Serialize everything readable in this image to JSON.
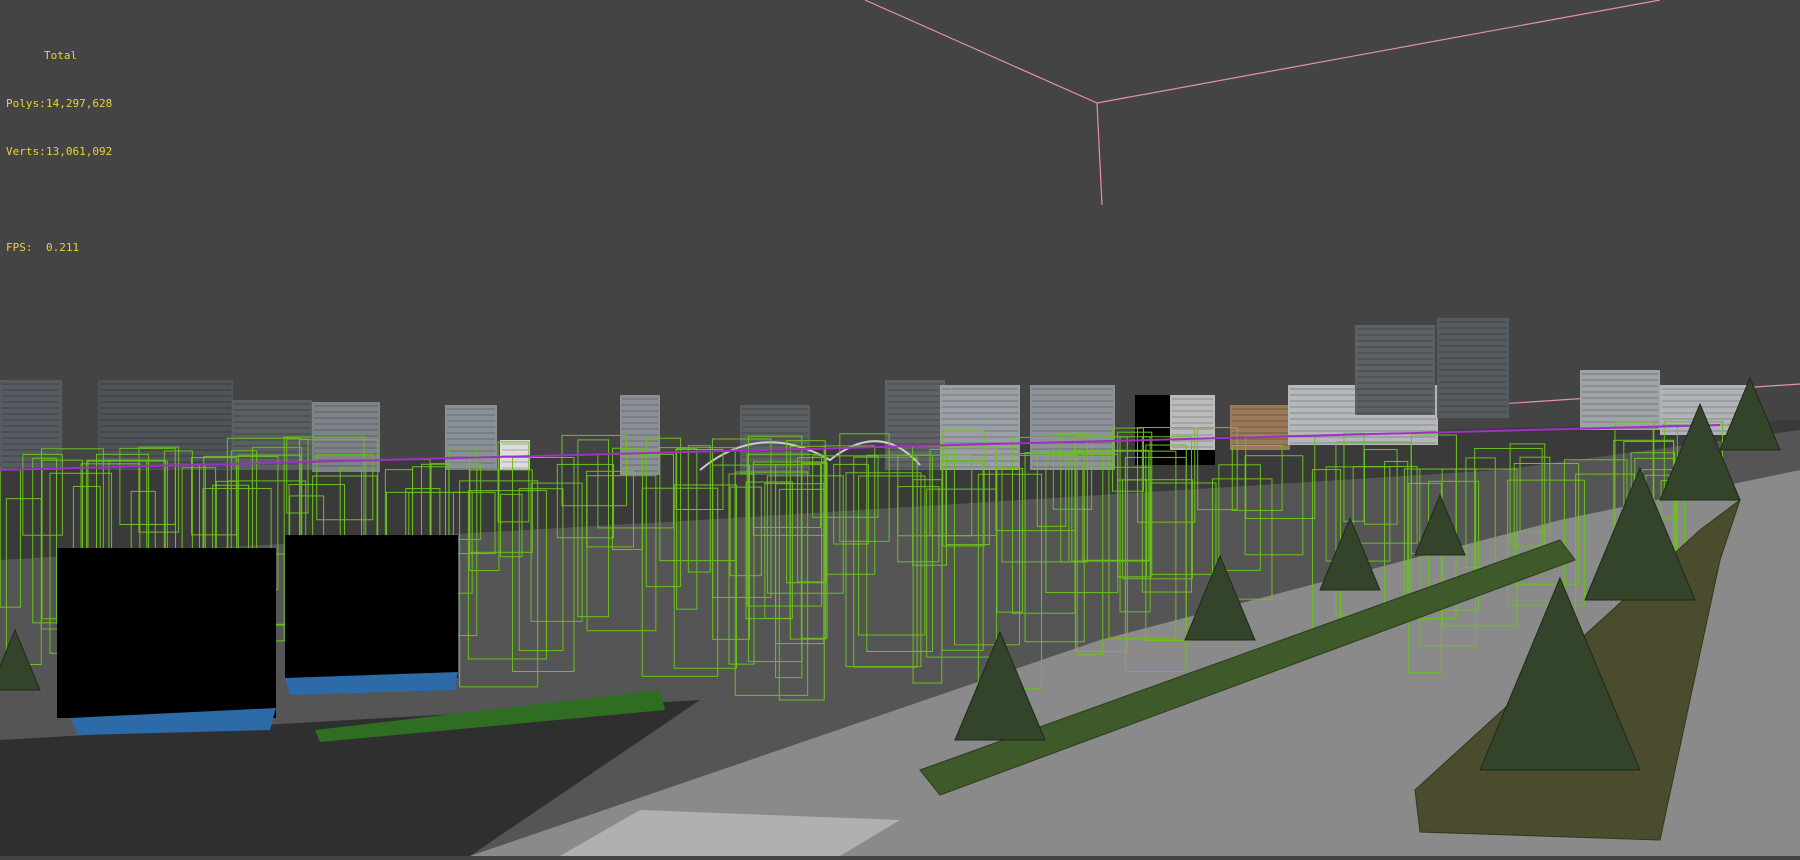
{
  "viewport": {
    "name": "Perspective viewport",
    "background": "#444444",
    "stats": {
      "header": "Total",
      "polys_label": "Polys:",
      "polys_value": "14,297,628",
      "verts_label": "Verts:",
      "verts_value": "13,061,092",
      "fps_label": "FPS:",
      "fps_value": "0.211",
      "color": "#e8d23a"
    },
    "colors": {
      "bbox_lines": "#e58fb0",
      "wireframe": "#6cc01c",
      "selection": "#a030c0"
    }
  }
}
